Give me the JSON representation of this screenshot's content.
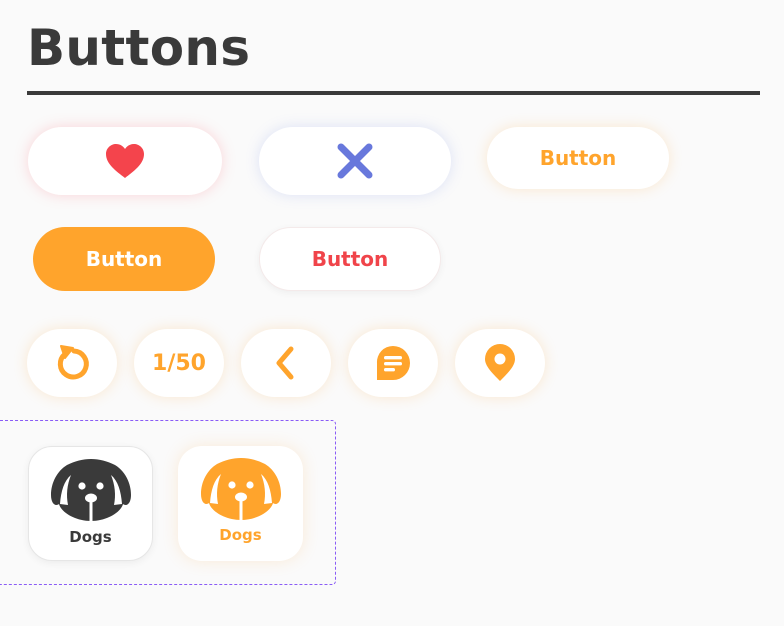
{
  "page": {
    "title": "Buttons"
  },
  "buttons_row1": {
    "heart_icon": "heart-icon",
    "close_icon": "close-icon",
    "text_button_label": "Button"
  },
  "buttons_row2": {
    "primary_label": "Button",
    "danger_label": "Button"
  },
  "icon_row": {
    "refresh_icon": "refresh-icon",
    "counter": "1/50",
    "back_icon": "chevron-left-icon",
    "chat_icon": "chat-icon",
    "location_icon": "location-pin-icon"
  },
  "category_tiles": [
    {
      "label": "Dogs",
      "icon": "dog-icon",
      "state": "default"
    },
    {
      "label": "Dogs",
      "icon": "dog-icon",
      "state": "selected"
    }
  ],
  "colors": {
    "accent_orange": "#ffa42c",
    "heart_red": "#f4444c",
    "close_blue": "#6878dc",
    "danger_red": "#f0444a",
    "text_dark": "#3a3a3a",
    "selection_dashed": "#8a5cf6"
  }
}
